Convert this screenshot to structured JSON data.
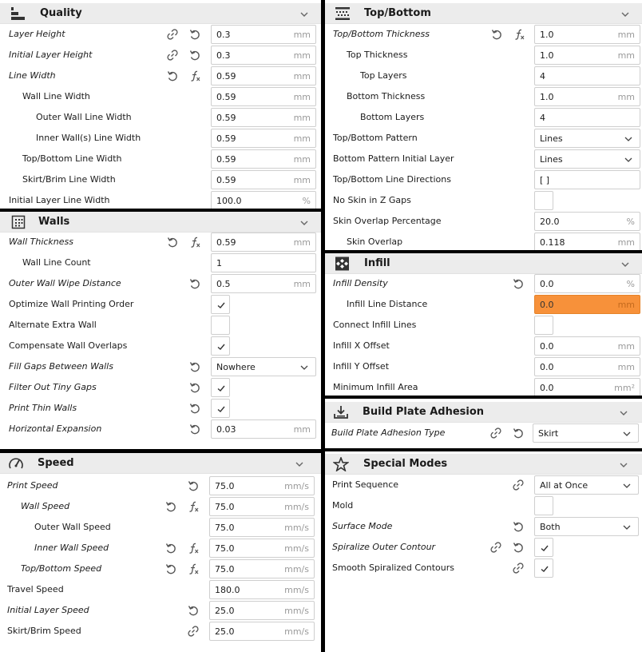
{
  "panels": {
    "quality": {
      "title": "Quality",
      "rows": {
        "layer_height": {
          "label": "Layer Height",
          "value": "0.3",
          "unit": "mm"
        },
        "initial_layer_height": {
          "label": "Initial Layer Height",
          "value": "0.3",
          "unit": "mm"
        },
        "line_width": {
          "label": "Line Width",
          "value": "0.59",
          "unit": "mm"
        },
        "wall_line_width": {
          "label": "Wall Line Width",
          "value": "0.59",
          "unit": "mm"
        },
        "outer_wall_line_width": {
          "label": "Outer Wall Line Width",
          "value": "0.59",
          "unit": "mm"
        },
        "inner_wall_line_width": {
          "label": "Inner Wall(s) Line Width",
          "value": "0.59",
          "unit": "mm"
        },
        "top_bottom_line_width": {
          "label": "Top/Bottom Line Width",
          "value": "0.59",
          "unit": "mm"
        },
        "skirt_brim_line_width": {
          "label": "Skirt/Brim Line Width",
          "value": "0.59",
          "unit": "mm"
        },
        "initial_layer_line_width": {
          "label": "Initial Layer Line Width",
          "value": "100.0",
          "unit": "%"
        }
      }
    },
    "walls": {
      "title": "Walls",
      "rows": {
        "wall_thickness": {
          "label": "Wall Thickness",
          "value": "0.59",
          "unit": "mm"
        },
        "wall_line_count": {
          "label": "Wall Line Count",
          "value": "1"
        },
        "outer_wall_wipe": {
          "label": "Outer Wall Wipe Distance",
          "value": "0.5",
          "unit": "mm"
        },
        "optimize_order": {
          "label": "Optimize Wall Printing Order",
          "checked": true
        },
        "alternate_extra": {
          "label": "Alternate Extra Wall",
          "checked": false
        },
        "compensate_overlaps": {
          "label": "Compensate Wall Overlaps",
          "checked": true
        },
        "fill_gaps": {
          "label": "Fill Gaps Between Walls",
          "value": "Nowhere"
        },
        "filter_tiny_gaps": {
          "label": "Filter Out Tiny Gaps",
          "checked": true
        },
        "print_thin_walls": {
          "label": "Print Thin Walls",
          "checked": true
        },
        "horizontal_expansion": {
          "label": "Horizontal Expansion",
          "value": "0.03",
          "unit": "mm"
        }
      }
    },
    "speed": {
      "title": "Speed",
      "rows": {
        "print_speed": {
          "label": "Print Speed",
          "value": "75.0",
          "unit": "mm/s"
        },
        "wall_speed": {
          "label": "Wall Speed",
          "value": "75.0",
          "unit": "mm/s"
        },
        "outer_wall_speed": {
          "label": "Outer Wall Speed",
          "value": "75.0",
          "unit": "mm/s"
        },
        "inner_wall_speed": {
          "label": "Inner Wall Speed",
          "value": "75.0",
          "unit": "mm/s"
        },
        "top_bottom_speed": {
          "label": "Top/Bottom Speed",
          "value": "75.0",
          "unit": "mm/s"
        },
        "travel_speed": {
          "label": "Travel Speed",
          "value": "180.0",
          "unit": "mm/s"
        },
        "initial_layer_speed": {
          "label": "Initial Layer Speed",
          "value": "25.0",
          "unit": "mm/s"
        },
        "skirt_brim_speed": {
          "label": "Skirt/Brim Speed",
          "value": "25.0",
          "unit": "mm/s"
        }
      }
    },
    "topbottom": {
      "title": "Top/Bottom",
      "rows": {
        "tb_thickness": {
          "label": "Top/Bottom Thickness",
          "value": "1.0",
          "unit": "mm"
        },
        "top_thickness": {
          "label": "Top Thickness",
          "value": "1.0",
          "unit": "mm"
        },
        "top_layers": {
          "label": "Top Layers",
          "value": "4"
        },
        "bottom_thickness": {
          "label": "Bottom Thickness",
          "value": "1.0",
          "unit": "mm"
        },
        "bottom_layers": {
          "label": "Bottom Layers",
          "value": "4"
        },
        "tb_pattern": {
          "label": "Top/Bottom Pattern",
          "value": "Lines"
        },
        "bottom_pattern_initial": {
          "label": "Bottom Pattern Initial Layer",
          "value": "Lines"
        },
        "tb_line_directions": {
          "label": "Top/Bottom Line Directions",
          "value": "[ ]"
        },
        "no_skin_z_gaps": {
          "label": "No Skin in Z Gaps",
          "checked": false
        },
        "skin_overlap_pct": {
          "label": "Skin Overlap Percentage",
          "value": "20.0",
          "unit": "%"
        },
        "skin_overlap": {
          "label": "Skin Overlap",
          "value": "0.118",
          "unit": "mm"
        }
      }
    },
    "infill": {
      "title": "Infill",
      "rows": {
        "infill_density": {
          "label": "Infill Density",
          "value": "0.0",
          "unit": "%"
        },
        "infill_line_distance": {
          "label": "Infill Line Distance",
          "value": "0.0",
          "unit": "mm"
        },
        "connect_infill_lines": {
          "label": "Connect Infill Lines",
          "checked": false
        },
        "infill_x_offset": {
          "label": "Infill X Offset",
          "value": "0.0",
          "unit": "mm"
        },
        "infill_y_offset": {
          "label": "Infill Y Offset",
          "value": "0.0",
          "unit": "mm"
        },
        "min_infill_area": {
          "label": "Minimum Infill Area",
          "value": "0.0",
          "unit": "mm²"
        }
      }
    },
    "adhesion": {
      "title": "Build Plate Adhesion",
      "rows": {
        "adhesion_type": {
          "label": "Build Plate Adhesion Type",
          "value": "Skirt"
        }
      }
    },
    "special": {
      "title": "Special Modes",
      "rows": {
        "print_sequence": {
          "label": "Print Sequence",
          "value": "All at Once"
        },
        "mold": {
          "label": "Mold",
          "checked": false
        },
        "surface_mode": {
          "label": "Surface Mode",
          "value": "Both"
        },
        "spiralize": {
          "label": "Spiralize Outer Contour",
          "checked": true
        },
        "smooth_spiralized": {
          "label": "Smooth Spiralized Contours",
          "checked": true
        }
      }
    }
  },
  "colors": {
    "warning": "#f7913a",
    "header_bg": "#ececec",
    "divider": "#000000"
  }
}
